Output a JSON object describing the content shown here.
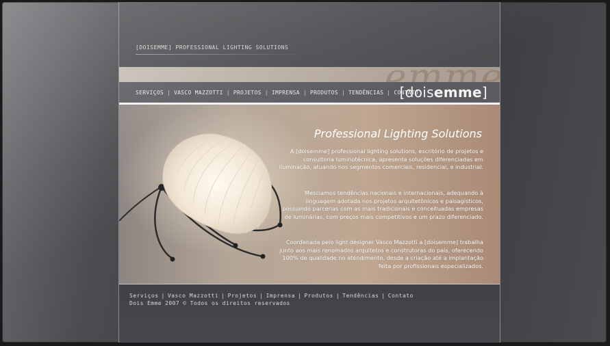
{
  "header": {
    "tagline": "[DOISEMME] PROFESSIONAL LIGHTING SOLUTIONS",
    "logo_light": "[dois",
    "logo_bold": "emme",
    "logo_close": "]"
  },
  "nav": {
    "items": [
      {
        "label": "SERVIÇOS"
      },
      {
        "label": "VASCO MAZZOTTI"
      },
      {
        "label": "PROJETOS"
      },
      {
        "label": "IMPRENSA"
      },
      {
        "label": "PRODUTOS"
      },
      {
        "label": "TENDÊNCIAS"
      },
      {
        "label": "CONTATO"
      }
    ],
    "separator": "|"
  },
  "hero": {
    "title": "Professional Lighting Solutions",
    "paragraphs": [
      "A [doisemme] professional lighting solutions, escritório de projetos e consultoria luminotécnica, apresenta soluções diferenciadas em iluminação, atuando nos segmentos comerciais, residencial, e industrial.",
      "Mesclamos tendências nacionais e internacionais, adequando à linguagem adotada nos projetos arquitetônicos e paisagísticos, possuindo parcerias com as mais tradicionais e conceituadas empresas de luminárias, com preços mais competitivos e um prazo diferenciado.",
      "Coordenada pelo light designer Vasco Mazzotti a [doisemme] trabalha junto aos mais renomados arquitetos e construtoras do país, oferecendo 100% de qualidade no atendimento, desde a criação até a implantação feita por profissionais especializados."
    ]
  },
  "footer": {
    "links": [
      {
        "label": "Serviços"
      },
      {
        "label": "Vasco Mazzotti"
      },
      {
        "label": "Projetos"
      },
      {
        "label": "Imprensa"
      },
      {
        "label": "Produtos"
      },
      {
        "label": "Tendências"
      },
      {
        "label": "Contato"
      }
    ],
    "separator": "|",
    "copyright": "Dois Emme 2007 © Todos os direitos reservados"
  },
  "watermark_text": "emme",
  "icons": {
    "lamp": "lamp-image"
  },
  "colors": {
    "accent_band": "#c6bdb3",
    "nav_bg": "#5a5c5f",
    "hero_warm": "#bfa792"
  }
}
